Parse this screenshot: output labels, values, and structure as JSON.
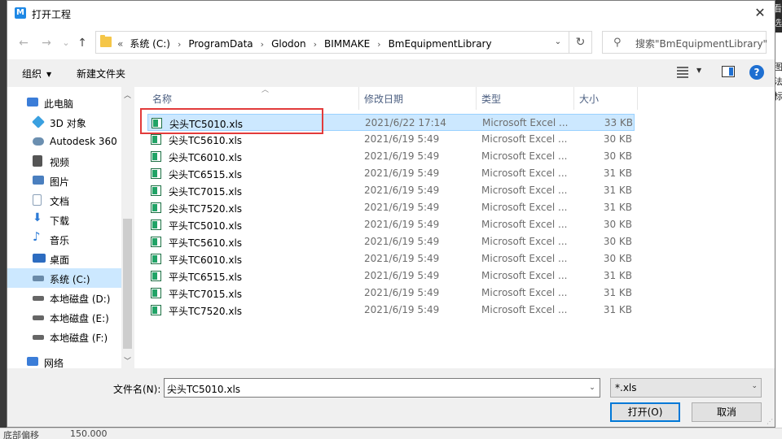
{
  "background": {
    "right_texts": [
      "看",
      "选",
      "图",
      "法",
      "标"
    ],
    "bottom_texts": [
      "底部偏移",
      "150.000"
    ]
  },
  "dialog": {
    "title": "打开工程",
    "app_icon_letter": "M",
    "close": "✕"
  },
  "nav": {
    "back": "←",
    "forward": "→",
    "recent": "⌄",
    "up": "↑"
  },
  "address": {
    "prefix": "«",
    "crumbs": [
      "系统 (C:)",
      "ProgramData",
      "Glodon",
      "BIMMAKE",
      "BmEquipmentLibrary"
    ],
    "separator": "›",
    "dropdown": "⌄",
    "refresh": "↻"
  },
  "search": {
    "placeholder": "搜索\"BmEquipmentLibrary\""
  },
  "toolbar": {
    "organize": "组织",
    "new_folder": "新建文件夹",
    "help": "?"
  },
  "sidebar": {
    "items": [
      {
        "label": "此电脑",
        "icon": "computer-icon",
        "color": "#3b7dd8"
      },
      {
        "label": "3D 对象",
        "icon": "cube-icon",
        "color": "#3aa0e0"
      },
      {
        "label": "Autodesk 360",
        "icon": "cloud-icon",
        "color": "#6b8fb0"
      },
      {
        "label": "视频",
        "icon": "film-icon",
        "color": "#555555"
      },
      {
        "label": "图片",
        "icon": "picture-icon",
        "color": "#4a7fbf"
      },
      {
        "label": "文档",
        "icon": "document-icon",
        "color": "#8aa0b8"
      },
      {
        "label": "下载",
        "icon": "download-icon",
        "color": "#2b7ad6"
      },
      {
        "label": "音乐",
        "icon": "music-icon",
        "color": "#2b7ad6"
      },
      {
        "label": "桌面",
        "icon": "desktop-icon",
        "color": "#2d6cc0"
      },
      {
        "label": "系统 (C:)",
        "icon": "drive-c-icon",
        "color": "#6a8aa8",
        "selected": true
      },
      {
        "label": "本地磁盘 (D:)",
        "icon": "drive-icon",
        "color": "#666666"
      },
      {
        "label": "本地磁盘 (E:)",
        "icon": "drive-icon",
        "color": "#666666"
      },
      {
        "label": "本地磁盘 (F:)",
        "icon": "drive-icon",
        "color": "#666666"
      },
      {
        "label": "网络",
        "icon": "network-icon",
        "color": "#3b7dd8"
      }
    ],
    "scroll_up": "︿",
    "scroll_down": "﹀"
  },
  "columns": {
    "name": "名称",
    "date": "修改日期",
    "type": "类型",
    "size": "大小",
    "sort_caret": "︿"
  },
  "files": [
    {
      "name": "尖头TC5010.xls",
      "date": "2021/6/22 17:14",
      "type": "Microsoft Excel ...",
      "size": "33 KB",
      "selected": true
    },
    {
      "name": "尖头TC5610.xls",
      "date": "2021/6/19 5:49",
      "type": "Microsoft Excel ...",
      "size": "30 KB"
    },
    {
      "name": "尖头TC6010.xls",
      "date": "2021/6/19 5:49",
      "type": "Microsoft Excel ...",
      "size": "30 KB"
    },
    {
      "name": "尖头TC6515.xls",
      "date": "2021/6/19 5:49",
      "type": "Microsoft Excel ...",
      "size": "31 KB"
    },
    {
      "name": "尖头TC7015.xls",
      "date": "2021/6/19 5:49",
      "type": "Microsoft Excel ...",
      "size": "31 KB"
    },
    {
      "name": "尖头TC7520.xls",
      "date": "2021/6/19 5:49",
      "type": "Microsoft Excel ...",
      "size": "31 KB"
    },
    {
      "name": "平头TC5010.xls",
      "date": "2021/6/19 5:49",
      "type": "Microsoft Excel ...",
      "size": "30 KB"
    },
    {
      "name": "平头TC5610.xls",
      "date": "2021/6/19 5:49",
      "type": "Microsoft Excel ...",
      "size": "30 KB"
    },
    {
      "name": "平头TC6010.xls",
      "date": "2021/6/19 5:49",
      "type": "Microsoft Excel ...",
      "size": "30 KB"
    },
    {
      "name": "平头TC6515.xls",
      "date": "2021/6/19 5:49",
      "type": "Microsoft Excel ...",
      "size": "31 KB"
    },
    {
      "name": "平头TC7015.xls",
      "date": "2021/6/19 5:49",
      "type": "Microsoft Excel ...",
      "size": "31 KB"
    },
    {
      "name": "平头TC7520.xls",
      "date": "2021/6/19 5:49",
      "type": "Microsoft Excel ...",
      "size": "31 KB"
    }
  ],
  "footer": {
    "filename_label": "文件名(N):",
    "filename_value": "尖头TC5010.xls",
    "filter_value": "*.xls",
    "open_button": "打开(O)",
    "cancel_button": "取消"
  },
  "colors": {
    "selection": "#cce8ff",
    "highlight_box": "#e23b3b",
    "primary_border": "#0078d7"
  }
}
